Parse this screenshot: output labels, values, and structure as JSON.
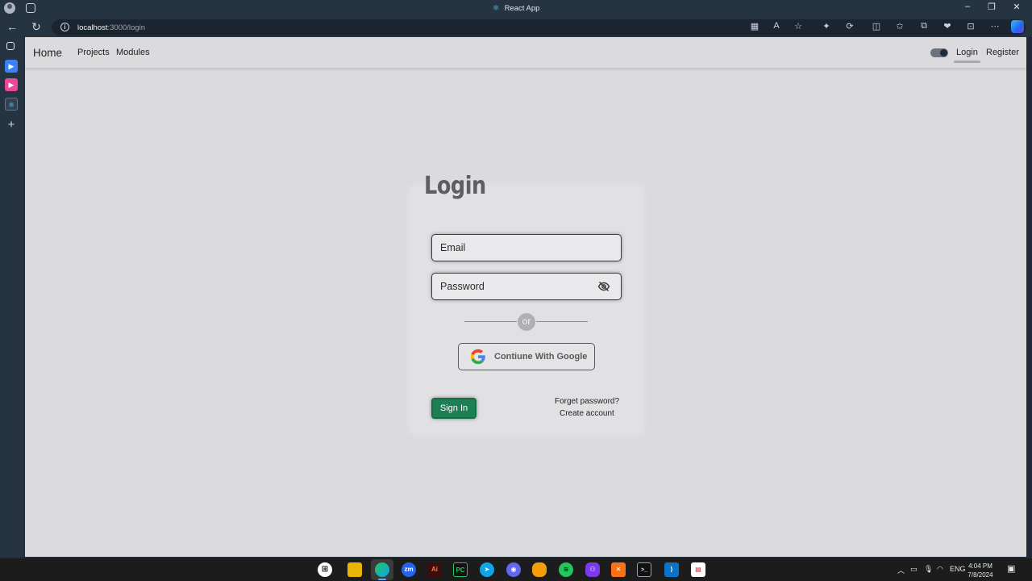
{
  "browser": {
    "tab_title": "React App",
    "url_host": "localhost",
    "url_path": ":3000/login",
    "accent": "#263341"
  },
  "navbar": {
    "brand": "Home",
    "links": [
      "Projects",
      "Modules"
    ],
    "right_links": [
      "Login",
      "Register"
    ],
    "active": "Login"
  },
  "login": {
    "title": "Login",
    "email_placeholder": "Email",
    "password_placeholder": "Password",
    "or_label": "or",
    "google_button": "Contiune With Google",
    "signin_button": "Sign In",
    "forgot_password": "Forget password?",
    "create_account": "Create account",
    "signin_color": "#1e7f55"
  },
  "taskbar": {
    "apps": [
      "start",
      "file-explorer",
      "edge",
      "zoom",
      "illustrator",
      "pycharm",
      "telegram",
      "discord",
      "postman",
      "spotify",
      "github-desktop",
      "xampp",
      "terminal",
      "vscode",
      "pdf-reader"
    ],
    "language": "ENG",
    "time": "4:04 PM",
    "date": "7/8/2024"
  }
}
